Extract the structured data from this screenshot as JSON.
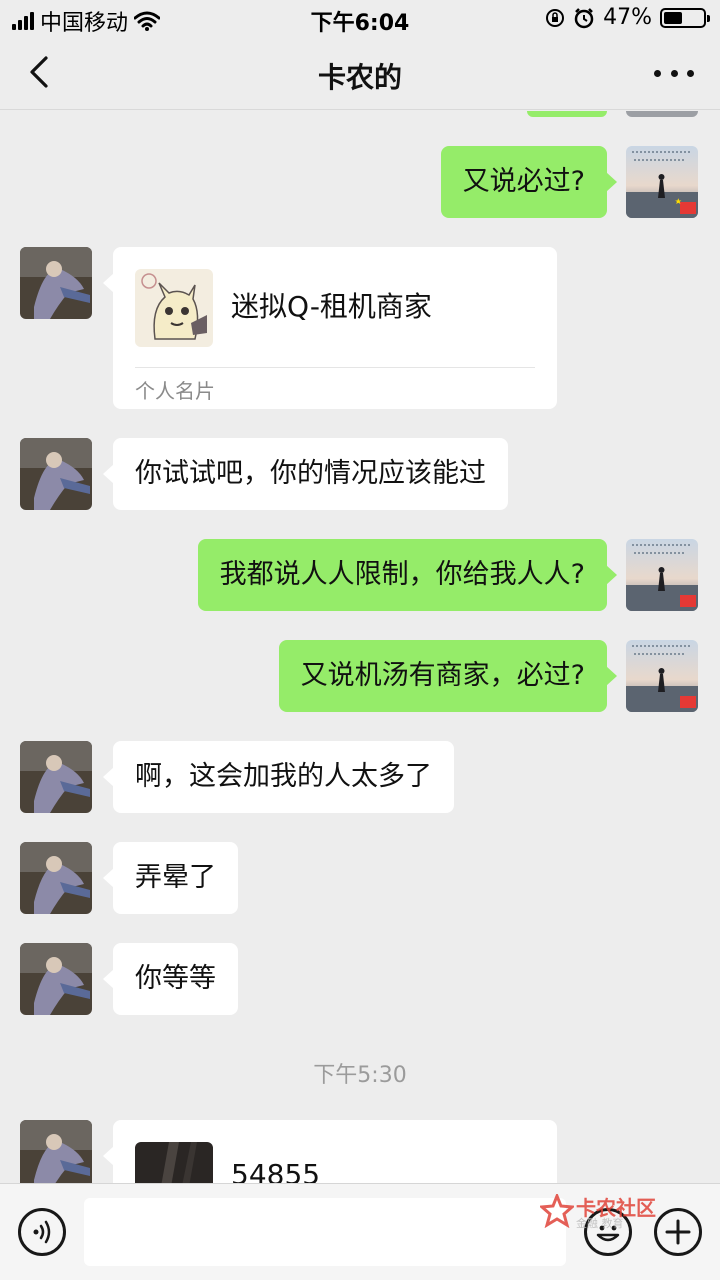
{
  "status_bar": {
    "carrier": "中国移动",
    "time": "下午6:04",
    "battery_percent": "47%",
    "battery_level": 0.47,
    "icons": [
      "signal-icon",
      "wifi-icon",
      "orientation-lock-icon",
      "alarm-icon",
      "battery-icon"
    ]
  },
  "nav": {
    "title": "卡农的",
    "back_icon": "chevron-left-icon",
    "more_icon": "more-dots-icon"
  },
  "messages": [
    {
      "direction": "out",
      "type": "text",
      "text": "又说必过?"
    },
    {
      "direction": "in",
      "type": "contact_card",
      "name": "迷拟Q-租机商家",
      "card_label": "个人名片"
    },
    {
      "direction": "in",
      "type": "text",
      "text": "你试试吧，你的情况应该能过"
    },
    {
      "direction": "out",
      "type": "text",
      "text": "我都说人人限制，你给我人人?"
    },
    {
      "direction": "out",
      "type": "text",
      "text": "又说机汤有商家，必过?"
    },
    {
      "direction": "in",
      "type": "text",
      "text": "啊，这会加我的人太多了"
    },
    {
      "direction": "in",
      "type": "text",
      "text": "弄晕了"
    },
    {
      "direction": "in",
      "type": "text",
      "text": "你等等"
    },
    {
      "type": "timestamp",
      "text": "下午5:30"
    },
    {
      "direction": "in",
      "type": "contact_card",
      "name": "54855"
    }
  ],
  "input_bar": {
    "voice_icon": "voice-icon",
    "emoji_icon": "emoji-icon",
    "plus_icon": "plus-icon",
    "input_value": ""
  },
  "watermark": {
    "title": "卡农社区",
    "subtitle": "金融 教育"
  },
  "colors": {
    "background": "#ededed",
    "outgoing_bubble": "#95ec69",
    "incoming_bubble": "#ffffff",
    "watermark_red": "#e0443a"
  }
}
